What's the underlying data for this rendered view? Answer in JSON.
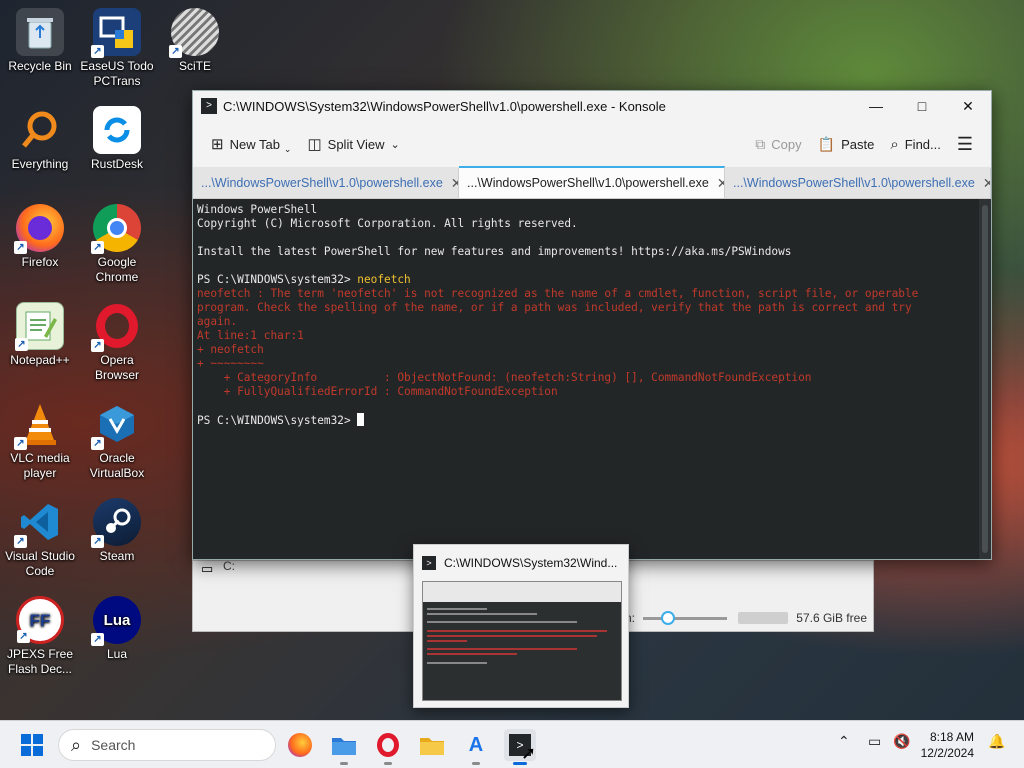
{
  "desktop": {
    "icons": [
      {
        "label": "Recycle Bin",
        "icon": "recycle-bin-icon"
      },
      {
        "label": "EaseUS Todo PCTrans",
        "icon": "easeus-icon"
      },
      {
        "label": "SciTE",
        "icon": "scite-icon"
      },
      {
        "label": "Everything",
        "icon": "everything-icon"
      },
      {
        "label": "RustDesk",
        "icon": "rustdesk-icon"
      },
      {
        "label": "Firefox",
        "icon": "firefox-icon"
      },
      {
        "label": "Google Chrome",
        "icon": "chrome-icon"
      },
      {
        "label": "Notepad++",
        "icon": "notepadpp-icon"
      },
      {
        "label": "Opera Browser",
        "icon": "opera-icon"
      },
      {
        "label": "VLC media player",
        "icon": "vlc-icon"
      },
      {
        "label": "Oracle VirtualBox",
        "icon": "virtualbox-icon"
      },
      {
        "label": "Visual Studio Code",
        "icon": "vscode-icon"
      },
      {
        "label": "Steam",
        "icon": "steam-icon"
      },
      {
        "label": "JPEXS Free Flash Dec...",
        "icon": "jpexs-icon"
      },
      {
        "label": "Lua",
        "icon": "lua-icon"
      }
    ]
  },
  "konsole": {
    "title": "C:\\WINDOWS\\System32\\WindowsPowerShell\\v1.0\\powershell.exe - Konsole",
    "toolbar": {
      "new_tab": "New Tab",
      "split_view": "Split View",
      "copy": "Copy",
      "paste": "Paste",
      "find": "Find..."
    },
    "tabs": [
      {
        "label": "...\\WindowsPowerShell\\v1.0\\powershell.exe",
        "active": false
      },
      {
        "label": "...\\WindowsPowerShell\\v1.0\\powershell.exe",
        "active": true
      },
      {
        "label": "...\\WindowsPowerShell\\v1.0\\powershell.exe",
        "active": false
      }
    ],
    "terminal": {
      "banner1": "Windows PowerShell",
      "banner2": "Copyright (C) Microsoft Corporation. All rights reserved.",
      "banner3": "Install the latest PowerShell for new features and improvements! https://aka.ms/PSWindows",
      "prompt1": "PS C:\\WINDOWS\\system32> ",
      "command": "neofetch",
      "err1": "neofetch : The term 'neofetch' is not recognized as the name of a cmdlet, function, script file, or operable",
      "err2": "program. Check the spelling of the name, or if a path was included, verify that the path is correct and try",
      "err3": "again.",
      "err4": "At line:1 char:1",
      "err5": "+ neofetch",
      "err6": "+ ~~~~~~~~",
      "err7": "    + CategoryInfo          : ObjectNotFound: (neofetch:String) [], CommandNotFoundException",
      "err8": "    + FullyQualifiedErrorId : CommandNotFoundException",
      "prompt2": "PS C:\\WINDOWS\\system32> "
    }
  },
  "behind_window": {
    "path_text": "C:",
    "free_space": "57.6 GiB free",
    "zoom_prefix": "n:"
  },
  "thumbnail": {
    "title": "C:\\WINDOWS\\System32\\Wind..."
  },
  "taskbar": {
    "search_placeholder": "Search",
    "time": "8:18 AM",
    "date": "12/2/2024"
  },
  "colors": {
    "accent": "#3daee9",
    "terminal_bg": "#232627",
    "error_text": "#c0392b",
    "command_text": "#f0c030"
  }
}
